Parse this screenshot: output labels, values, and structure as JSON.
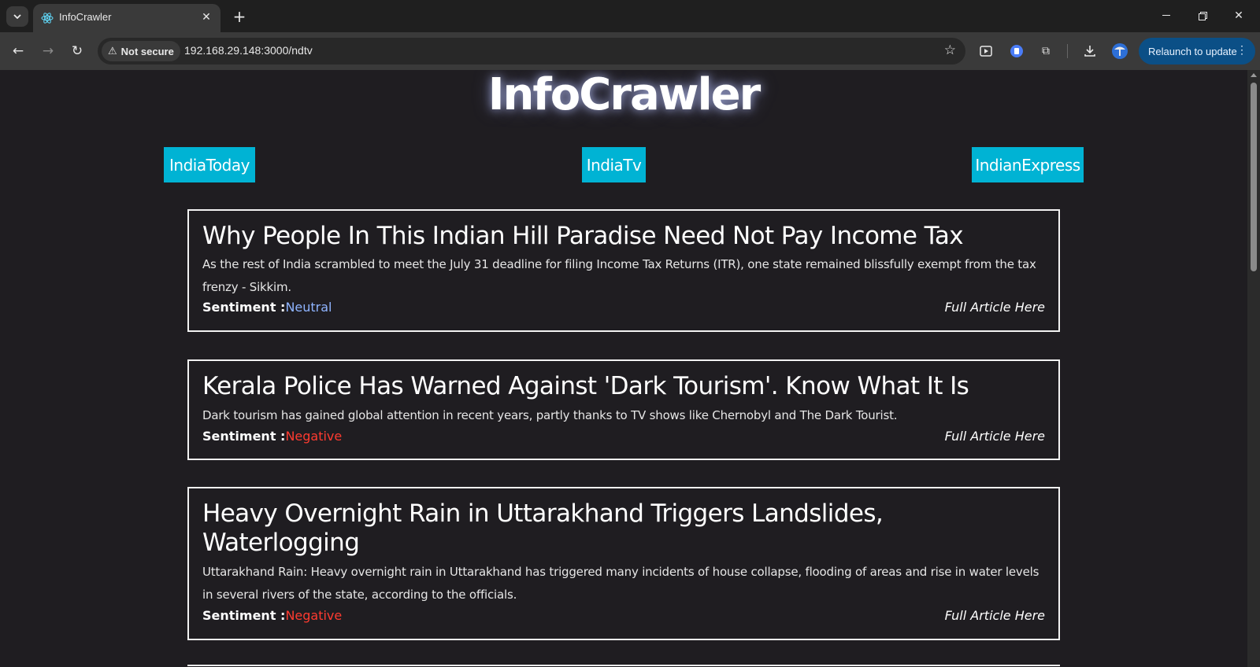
{
  "browser": {
    "tab_title": "InfoCrawler",
    "security_label": "Not secure",
    "url": "192.168.29.148:3000/ndtv",
    "relaunch_label": "Relaunch to update"
  },
  "page": {
    "title": "InfoCrawler",
    "sources": [
      {
        "label": "IndiaToday"
      },
      {
        "label": "IndiaTv"
      },
      {
        "label": "IndianExpress"
      }
    ],
    "articles": [
      {
        "title": "Why People In This Indian Hill Paradise Need Not Pay Income Tax",
        "description": "As the rest of India scrambled to meet the July 31 deadline for filing Income Tax Returns (ITR), one state remained blissfully exempt from the tax frenzy - Sikkim.",
        "sentiment_label": "Sentiment :",
        "sentiment": "Neutral",
        "link_label": "Full Article Here"
      },
      {
        "title": "Kerala Police Has Warned Against 'Dark Tourism'. Know What It Is",
        "description": "Dark tourism has gained global attention in recent years, partly thanks to TV shows like Chernobyl and The Dark Tourist.",
        "sentiment_label": "Sentiment :",
        "sentiment": "Negative",
        "link_label": "Full Article Here"
      },
      {
        "title": "Heavy Overnight Rain in Uttarakhand Triggers Landslides, Waterlogging",
        "description": "Uttarakhand Rain: Heavy overnight rain in Uttarakhand has triggered many incidents of house collapse, flooding of areas and rise in water levels in several rivers of the state, according to the officials.",
        "sentiment_label": "Sentiment :",
        "sentiment": "Negative",
        "link_label": "Full Article Here"
      }
    ]
  }
}
